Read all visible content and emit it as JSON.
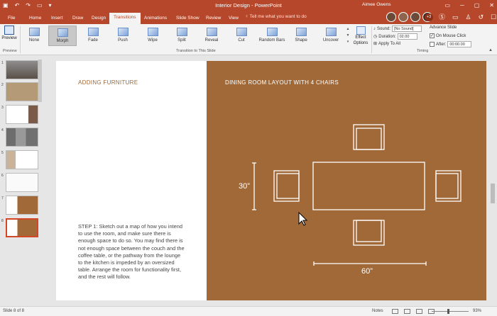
{
  "window": {
    "title": "Interior Design - PowerPoint",
    "user": "Aimee Owens"
  },
  "tabs": [
    "File",
    "Home",
    "Insert",
    "Draw",
    "Design",
    "Transitions",
    "Animations",
    "Slide Show",
    "Review",
    "View"
  ],
  "active_tab": "Transitions",
  "tell_me": "Tell me what you want to do",
  "share_badge": "+3",
  "ribbon": {
    "preview_label": "Preview",
    "preview_group": "Preview",
    "transitions_group": "Transition to This Slide",
    "transitions": [
      "None",
      "Morph",
      "Fade",
      "Push",
      "Wipe",
      "Split",
      "Reveal",
      "Cut",
      "Random Bars",
      "Shape",
      "Uncover"
    ],
    "selected_transition": "Morph",
    "effect_options_line1": "Effect",
    "effect_options_line2": "Options",
    "timing_group": "Timing",
    "sound_label": "Sound:",
    "sound_value": "[No Sound]",
    "duration_label": "Duration:",
    "duration_value": "02.00",
    "apply_to_all": "Apply To All",
    "advance_slide": "Advance Slide",
    "on_mouse_click": "On Mouse Click",
    "after_label": "After:",
    "after_value": "00:00.00"
  },
  "thumbnails": [
    "1",
    "2",
    "3",
    "4",
    "5",
    "6",
    "7",
    "8"
  ],
  "active_slide": 8,
  "slide": {
    "left_title": "ADDING FURNITURE",
    "step_text": "STEP 1: Sketch out a map of how you intend to use the room, and make sure there is enough space to do so. You may find there is not enough space between the couch and the coffee table, or the pathway from the lounge to the kitchen is impeded by an oversized table. Arrange the room for functionality first, and the rest will follow.",
    "right_title": "DINING ROOM LAYOUT WITH 4 CHAIRS",
    "dim_height": "30”",
    "dim_width": "60”"
  },
  "status": {
    "slide_indicator": "Slide 8 of 8",
    "notes": "Notes",
    "zoom": "93%"
  },
  "colors": {
    "brand": "#b7472a",
    "slide_accent": "#a06937"
  }
}
